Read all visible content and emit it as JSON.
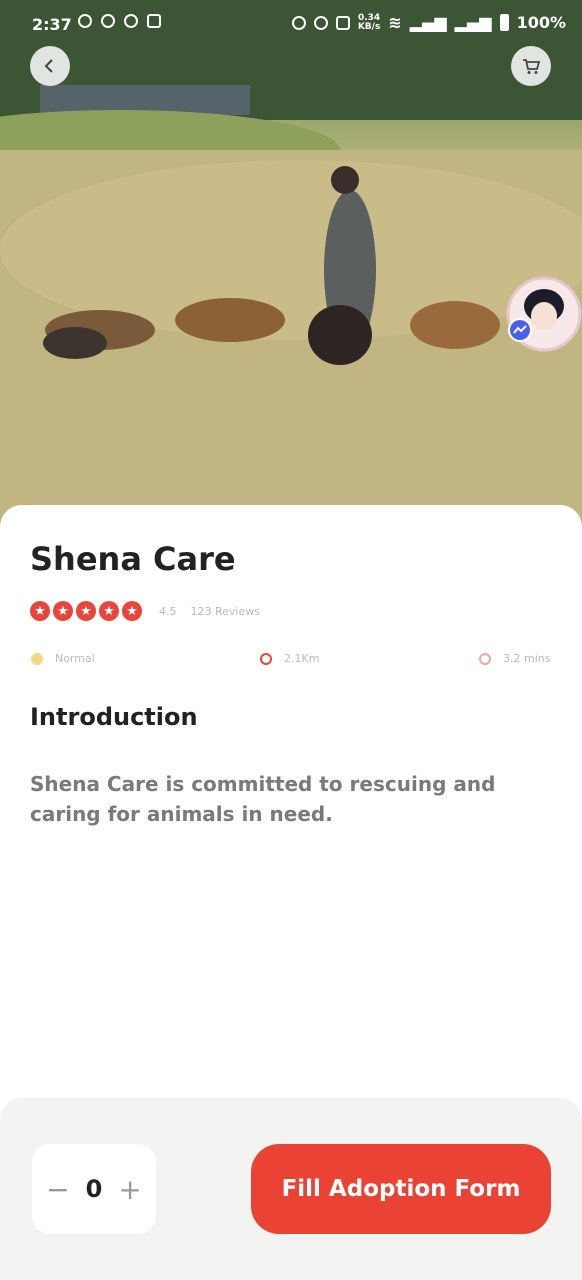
{
  "status_bar": {
    "time": "2:37",
    "net_speed_top": "0.34",
    "net_speed_bottom": "KB/s",
    "battery": "100%"
  },
  "place": {
    "name": "Shena Care",
    "rating": "4.5",
    "reviews": "123 Reviews",
    "stars": 5,
    "meta": {
      "level": "Normal",
      "distance": "2.1Km",
      "time": "3.2 mins"
    }
  },
  "intro": {
    "title": "Introduction",
    "text": "Shena Care is committed to rescuing and caring for animals in need."
  },
  "quantity": {
    "minus": "−",
    "value": "0",
    "plus": "+"
  },
  "cta": {
    "label": "Fill Adoption Form"
  },
  "colors": {
    "accent": "#ea4335",
    "star": "#e8453c",
    "level": "#f2d98a"
  }
}
